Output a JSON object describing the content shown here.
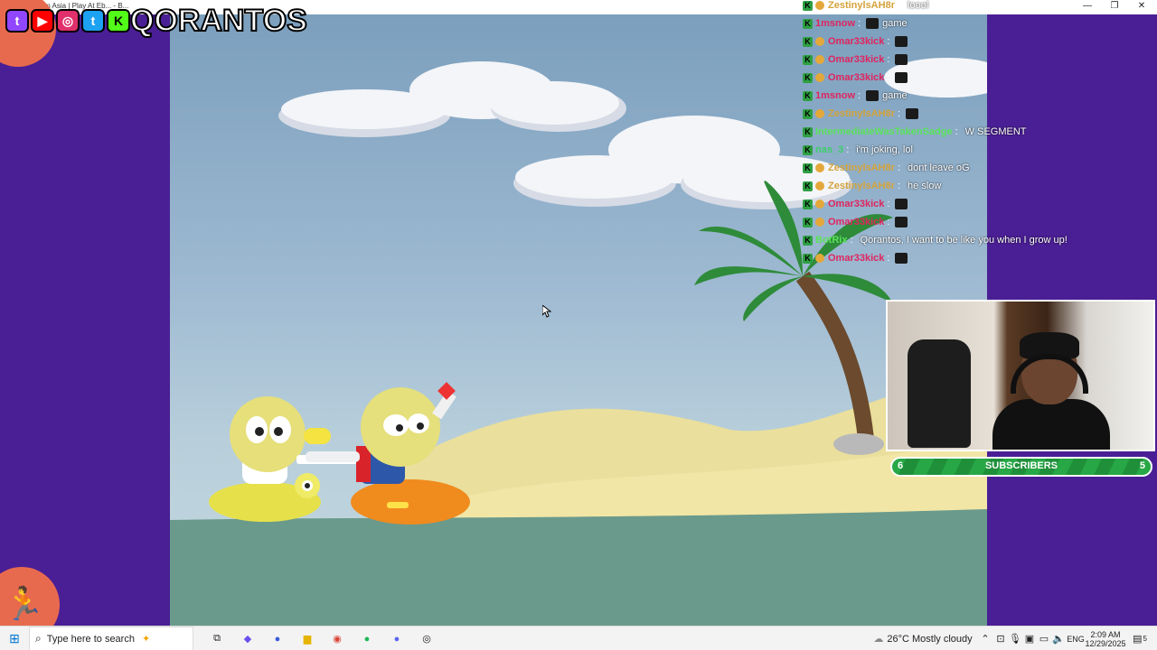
{
  "window": {
    "title": "Bob Wa... | I'm Asia | Play At Eb... - B...",
    "minimize": "—",
    "restore": "❐",
    "close": "✕"
  },
  "overlay": {
    "brand": "QORANTOS",
    "socials": [
      {
        "name": "twitch",
        "glyph": "t",
        "color": "#9146ff"
      },
      {
        "name": "youtube",
        "glyph": "▶",
        "color": "#ff0000"
      },
      {
        "name": "instagram",
        "glyph": "◎",
        "color": "#e1306c"
      },
      {
        "name": "twitter",
        "glyph": "t",
        "color": "#1da1f2"
      },
      {
        "name": "kick",
        "glyph": "K",
        "color": "#53fc18"
      }
    ]
  },
  "chat": {
    "messages": [
      {
        "user": "ZestinylsAH8r",
        "user_color": "#d4a33a",
        "text": "loool",
        "sub": true,
        "emote": false
      },
      {
        "user": "1msnow",
        "user_color": "#e0245e",
        "text": "game",
        "sub": false,
        "emote": true
      },
      {
        "user": "Omar33kick",
        "user_color": "#e0245e",
        "text": "",
        "sub": true,
        "emote": true
      },
      {
        "user": "Omar33kick",
        "user_color": "#e0245e",
        "text": "",
        "sub": true,
        "emote": true
      },
      {
        "user": "Omar33kick",
        "user_color": "#e0245e",
        "text": "",
        "sub": true,
        "emote": true
      },
      {
        "user": "1msnow",
        "user_color": "#e0245e",
        "text": "game",
        "sub": false,
        "emote": true
      },
      {
        "user": "ZestinylsAH8r",
        "user_color": "#d4a33a",
        "text": "",
        "sub": true,
        "emote": true
      },
      {
        "user": "IntermediateWasTakenSadge",
        "user_color": "#5be35b",
        "text": "W SEGMENT",
        "sub": false,
        "emote": false
      },
      {
        "user": "nas_3",
        "user_color": "#3ecf6b",
        "text": "i'm joking, lol",
        "sub": false,
        "emote": false
      },
      {
        "user": "ZestinylsAH8r",
        "user_color": "#d4a33a",
        "text": "dont leave oG",
        "sub": true,
        "emote": false
      },
      {
        "user": "ZestinylsAH8r",
        "user_color": "#d4a33a",
        "text": "he slow",
        "sub": true,
        "emote": false
      },
      {
        "user": "Omar33kick",
        "user_color": "#e0245e",
        "text": "",
        "sub": true,
        "emote": true
      },
      {
        "user": "Omar33kick",
        "user_color": "#e0245e",
        "text": "",
        "sub": true,
        "emote": true
      },
      {
        "user": "BotRix",
        "user_color": "#5be35b",
        "text": "Qorantos, I want to be like you when I grow up!",
        "sub": false,
        "emote": false
      },
      {
        "user": "Omar33kick",
        "user_color": "#e0245e",
        "text": "",
        "sub": true,
        "emote": true
      }
    ]
  },
  "subscribers": {
    "current": "6",
    "label": "SUBSCRIBERS",
    "goal": "5",
    "progress": 1.0
  },
  "taskbar": {
    "search_placeholder": "Type here to search",
    "weather": "26°C  Mostly cloudy",
    "lang": "ENG",
    "time": "2:09 AM",
    "date": "12/29/2025",
    "notif_count": "5",
    "pinned": [
      "task-view",
      "copilot",
      "app-blue",
      "file-explorer",
      "chrome",
      "spotify",
      "discord",
      "obs"
    ]
  }
}
